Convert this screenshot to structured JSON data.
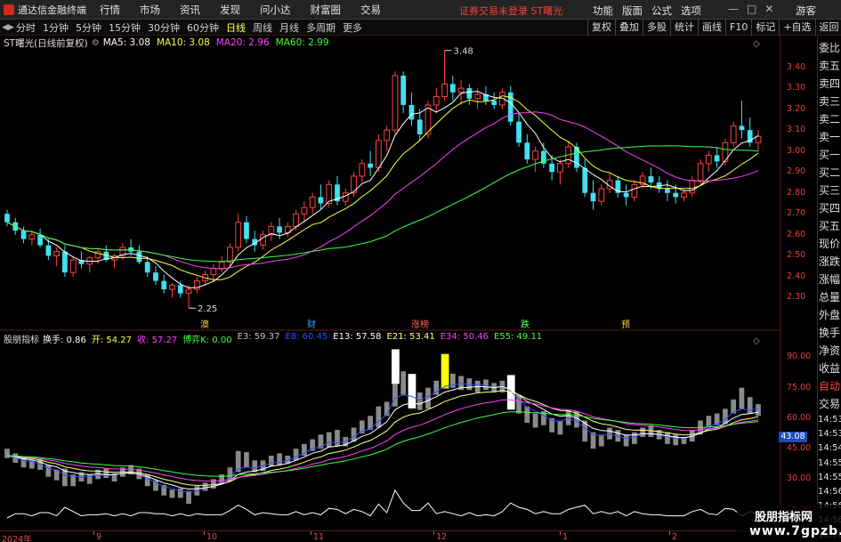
{
  "app": {
    "title": "通达信金融终端",
    "menus": [
      "行情",
      "市场",
      "资讯",
      "发现",
      "问小达",
      "财富圈",
      "交易"
    ],
    "login_status": "证券交易未登录  ST曙光",
    "right_menus": [
      "功能",
      "版面",
      "公式",
      "选项"
    ],
    "window_controls": [
      "—",
      "□",
      "✕"
    ],
    "guest": "游客"
  },
  "toolbar": {
    "periods": [
      "分时",
      "1分钟",
      "5分钟",
      "15分钟",
      "30分钟",
      "60分钟",
      "日线",
      "周线",
      "月线",
      "多周期",
      "更多"
    ],
    "active_period": "日线",
    "right_buttons": [
      "复权",
      "叠加",
      "多股",
      "统计",
      "画线",
      "F10",
      "标记",
      "+自选",
      "返回"
    ]
  },
  "kline_info": {
    "stock": "ST曙光(日线前复权)",
    "ma": [
      {
        "label": "MA5: 3.08",
        "color": "#ffffff"
      },
      {
        "label": "MA10: 3.08",
        "color": "#ffff40"
      },
      {
        "label": "MA20: 2.96",
        "color": "#ff40ff"
      },
      {
        "label": "MA60: 2.99",
        "color": "#40ff40"
      }
    ],
    "high_label": "3.48",
    "low_label": "2.25",
    "event_tags": [
      {
        "label": "澳",
        "color": "#ffd040"
      },
      {
        "label": "财",
        "color": "#40a0ff"
      },
      {
        "label": "涨榜",
        "color": "#ff6060"
      },
      {
        "label": "跌",
        "color": "#60ff60"
      },
      {
        "label": "预",
        "color": "#ffd040"
      }
    ]
  },
  "price_axis": [
    "3.40",
    "3.30",
    "3.20",
    "3.10",
    "3.00",
    "2.90",
    "2.80",
    "2.70",
    "2.60",
    "2.50",
    "2.40",
    "2.30"
  ],
  "indicator_info": {
    "title": "股朋指标",
    "values": [
      {
        "label": "换手: 0.86",
        "color": "#ffffff"
      },
      {
        "label": "开: 54.27",
        "color": "#ffff40"
      },
      {
        "label": "收: 57.27",
        "color": "#ff40ff"
      },
      {
        "label": "博弈K: 0.00",
        "color": "#40ff40"
      },
      {
        "label": "E3: 59.37",
        "color": "#c0c0c0"
      },
      {
        "label": "E8: 60.45",
        "color": "#3050ff"
      },
      {
        "label": "E13: 57.58",
        "color": "#ffffff"
      },
      {
        "label": "E21: 53.41",
        "color": "#ffff80"
      },
      {
        "label": "E34: 50.46",
        "color": "#ff40ff"
      },
      {
        "label": "E55: 49.11",
        "color": "#40ff40"
      }
    ]
  },
  "indicator_axis": [
    "90.00",
    "75.00",
    "60.00",
    "45.00",
    "30.00",
    "15.00"
  ],
  "current_indicator_value": "43.08",
  "date_axis": [
    "2024年",
    "9",
    "10",
    "11",
    "12",
    "1",
    "2"
  ],
  "side_panel": {
    "tabs": [
      "委比",
      "卖五",
      "卖四",
      "卖三",
      "卖二",
      "卖一",
      "买一",
      "买二",
      "买三",
      "买四",
      "买五",
      "现价",
      "涨跌",
      "涨幅",
      "总量",
      "外盘",
      "换手",
      "净资",
      "收益"
    ],
    "lower_tabs": [
      {
        "label": "自动",
        "color": "#ff4040"
      },
      {
        "label": "交易",
        "color": "#e0e0e0"
      }
    ],
    "times": [
      "14:53",
      "14:53",
      "14:54",
      "14:55",
      "14:55",
      "14:56",
      "14:56",
      "14:56",
      "14:56",
      "14:56"
    ]
  },
  "watermark": {
    "line1": "股朋指标网",
    "line2": "www.7gpzb.com"
  },
  "colors": {
    "up": "#ff4040",
    "down": "#40e0f0",
    "ma5": "#ffffff",
    "ma10": "#ffff40",
    "ma20": "#ff40ff",
    "ma60": "#40ff40"
  },
  "chart_data": {
    "type": "candlestick",
    "ohlc": [
      [
        2.7,
        2.72,
        2.64,
        2.66
      ],
      [
        2.66,
        2.68,
        2.6,
        2.62
      ],
      [
        2.62,
        2.64,
        2.56,
        2.58
      ],
      [
        2.58,
        2.62,
        2.55,
        2.6
      ],
      [
        2.6,
        2.63,
        2.54,
        2.55
      ],
      [
        2.55,
        2.58,
        2.48,
        2.5
      ],
      [
        2.5,
        2.54,
        2.45,
        2.52
      ],
      [
        2.52,
        2.55,
        2.4,
        2.42
      ],
      [
        2.42,
        2.5,
        2.4,
        2.48
      ],
      [
        2.48,
        2.52,
        2.44,
        2.46
      ],
      [
        2.46,
        2.5,
        2.42,
        2.49
      ],
      [
        2.49,
        2.54,
        2.46,
        2.52
      ],
      [
        2.52,
        2.55,
        2.47,
        2.48
      ],
      [
        2.48,
        2.51,
        2.44,
        2.5
      ],
      [
        2.5,
        2.56,
        2.48,
        2.54
      ],
      [
        2.54,
        2.58,
        2.5,
        2.52
      ],
      [
        2.52,
        2.55,
        2.46,
        2.47
      ],
      [
        2.47,
        2.5,
        2.4,
        2.42
      ],
      [
        2.42,
        2.45,
        2.36,
        2.38
      ],
      [
        2.38,
        2.41,
        2.32,
        2.34
      ],
      [
        2.34,
        2.37,
        2.3,
        2.36
      ],
      [
        2.36,
        2.38,
        2.3,
        2.32
      ],
      [
        2.32,
        2.36,
        2.25,
        2.34
      ],
      [
        2.34,
        2.4,
        2.32,
        2.38
      ],
      [
        2.38,
        2.43,
        2.36,
        2.41
      ],
      [
        2.41,
        2.46,
        2.38,
        2.44
      ],
      [
        2.44,
        2.5,
        2.42,
        2.47
      ],
      [
        2.47,
        2.56,
        2.45,
        2.54
      ],
      [
        2.54,
        2.7,
        2.52,
        2.66
      ],
      [
        2.66,
        2.69,
        2.56,
        2.58
      ],
      [
        2.58,
        2.62,
        2.52,
        2.55
      ],
      [
        2.55,
        2.62,
        2.53,
        2.6
      ],
      [
        2.6,
        2.66,
        2.57,
        2.64
      ],
      [
        2.64,
        2.68,
        2.58,
        2.61
      ],
      [
        2.61,
        2.66,
        2.59,
        2.64
      ],
      [
        2.64,
        2.72,
        2.62,
        2.7
      ],
      [
        2.7,
        2.76,
        2.66,
        2.73
      ],
      [
        2.73,
        2.8,
        2.7,
        2.78
      ],
      [
        2.78,
        2.84,
        2.72,
        2.75
      ],
      [
        2.75,
        2.86,
        2.73,
        2.84
      ],
      [
        2.84,
        2.88,
        2.74,
        2.76
      ],
      [
        2.76,
        2.82,
        2.74,
        2.8
      ],
      [
        2.8,
        2.9,
        2.78,
        2.88
      ],
      [
        2.88,
        2.96,
        2.85,
        2.94
      ],
      [
        2.94,
        3.0,
        2.88,
        2.92
      ],
      [
        2.92,
        3.08,
        2.9,
        3.05
      ],
      [
        3.05,
        3.12,
        3.0,
        3.1
      ],
      [
        3.1,
        3.38,
        3.08,
        3.36
      ],
      [
        3.36,
        3.38,
        3.18,
        3.22
      ],
      [
        3.22,
        3.28,
        3.12,
        3.15
      ],
      [
        3.15,
        3.2,
        3.05,
        3.08
      ],
      [
        3.08,
        3.24,
        3.06,
        3.22
      ],
      [
        3.22,
        3.3,
        3.18,
        3.26
      ],
      [
        3.26,
        3.48,
        3.24,
        3.32
      ],
      [
        3.32,
        3.36,
        3.24,
        3.28
      ],
      [
        3.28,
        3.34,
        3.22,
        3.3
      ],
      [
        3.3,
        3.32,
        3.22,
        3.25
      ],
      [
        3.25,
        3.3,
        3.2,
        3.27
      ],
      [
        3.27,
        3.31,
        3.22,
        3.24
      ],
      [
        3.24,
        3.28,
        3.2,
        3.22
      ],
      [
        3.22,
        3.3,
        3.2,
        3.28
      ],
      [
        3.28,
        3.31,
        3.12,
        3.14
      ],
      [
        3.14,
        3.18,
        3.02,
        3.04
      ],
      [
        3.04,
        3.08,
        2.94,
        2.96
      ],
      [
        2.96,
        3.02,
        2.9,
        3.0
      ],
      [
        3.0,
        3.04,
        2.92,
        2.94
      ],
      [
        2.94,
        2.98,
        2.86,
        2.9
      ],
      [
        2.9,
        2.96,
        2.84,
        2.94
      ],
      [
        2.94,
        3.05,
        2.92,
        3.02
      ],
      [
        3.02,
        3.04,
        2.9,
        2.92
      ],
      [
        2.92,
        2.96,
        2.78,
        2.8
      ],
      [
        2.8,
        2.86,
        2.72,
        2.76
      ],
      [
        2.76,
        2.84,
        2.74,
        2.82
      ],
      [
        2.82,
        2.9,
        2.8,
        2.86
      ],
      [
        2.86,
        2.88,
        2.78,
        2.8
      ],
      [
        2.8,
        2.84,
        2.74,
        2.78
      ],
      [
        2.78,
        2.86,
        2.76,
        2.84
      ],
      [
        2.84,
        2.9,
        2.82,
        2.88
      ],
      [
        2.88,
        2.92,
        2.82,
        2.85
      ],
      [
        2.85,
        2.88,
        2.8,
        2.82
      ],
      [
        2.82,
        2.86,
        2.76,
        2.8
      ],
      [
        2.8,
        2.84,
        2.75,
        2.78
      ],
      [
        2.78,
        2.82,
        2.76,
        2.8
      ],
      [
        2.8,
        2.88,
        2.78,
        2.86
      ],
      [
        2.86,
        2.96,
        2.84,
        2.94
      ],
      [
        2.94,
        3.0,
        2.9,
        2.98
      ],
      [
        2.98,
        3.02,
        2.92,
        2.95
      ],
      [
        2.95,
        3.06,
        2.93,
        3.04
      ],
      [
        3.04,
        3.14,
        3.02,
        3.12
      ],
      [
        3.12,
        3.24,
        3.06,
        3.1
      ],
      [
        3.1,
        3.16,
        3.02,
        3.04
      ],
      [
        3.04,
        3.1,
        3.0,
        3.07
      ]
    ],
    "ylim": [
      2.2,
      3.5
    ],
    "indicator_ylim": [
      10,
      95
    ]
  }
}
